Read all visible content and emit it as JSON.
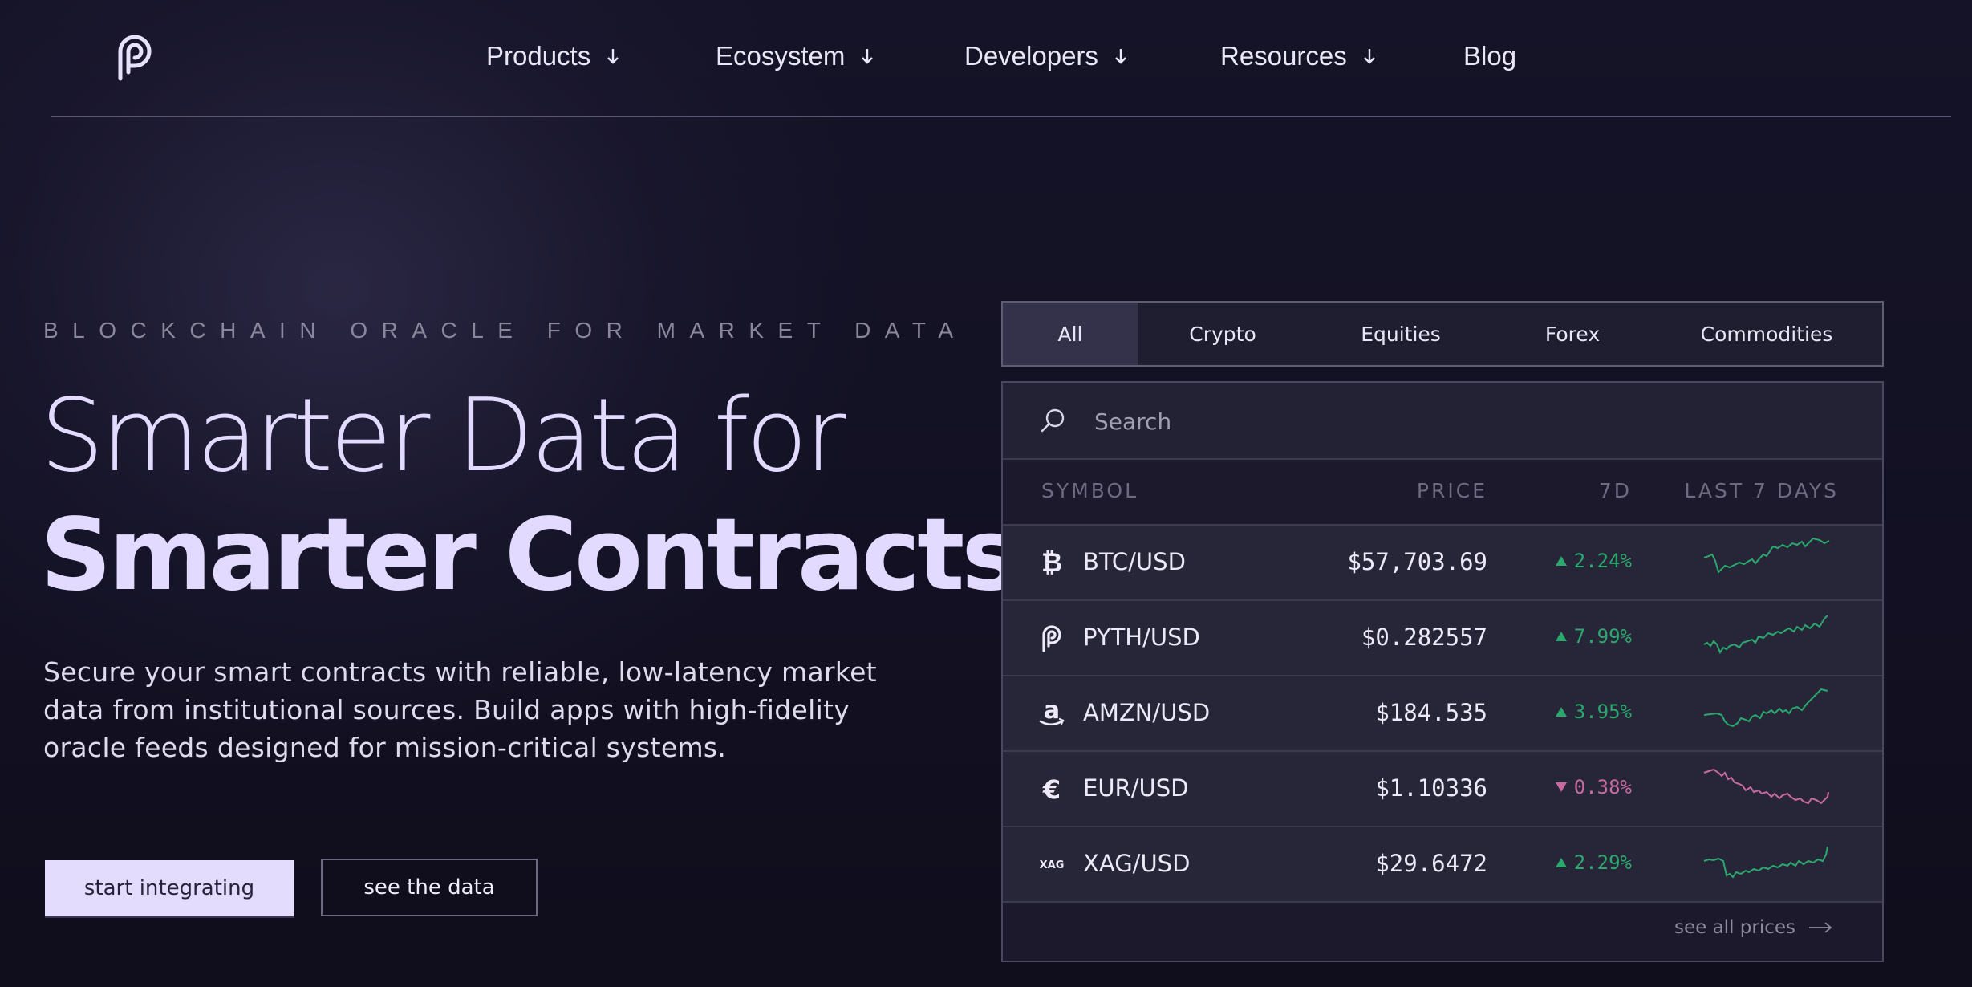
{
  "nav": {
    "items": [
      {
        "label": "Products",
        "has_dropdown": true
      },
      {
        "label": "Ecosystem",
        "has_dropdown": true
      },
      {
        "label": "Developers",
        "has_dropdown": true
      },
      {
        "label": "Resources",
        "has_dropdown": true
      },
      {
        "label": "Blog",
        "has_dropdown": false
      }
    ]
  },
  "hero": {
    "eyebrow": "BLOCKCHAIN ORACLE FOR MARKET DATA",
    "title_line1": "Smarter Data for",
    "title_line2": "Smarter Contracts",
    "description": "Secure your smart contracts with reliable, low-latency market data from institutional sources. Build apps with high-fidelity oracle feeds designed for mission-critical systems.",
    "primary_button": "start integrating",
    "secondary_button": "see the data"
  },
  "prices": {
    "tabs": [
      {
        "label": "All",
        "active": true
      },
      {
        "label": "Crypto",
        "active": false
      },
      {
        "label": "Equities",
        "active": false
      },
      {
        "label": "Forex",
        "active": false
      },
      {
        "label": "Commodities",
        "active": false
      }
    ],
    "search_placeholder": "Search",
    "columns": {
      "symbol": "SYMBOL",
      "price": "PRICE",
      "change": "7D",
      "trend": "LAST 7 DAYS"
    },
    "rows": [
      {
        "icon": "bitcoin-icon",
        "symbol": "BTC/USD",
        "price": "$57,703.69",
        "change": "2.24%",
        "direction": "up",
        "color": "#2aa86d"
      },
      {
        "icon": "pyth-icon",
        "symbol": "PYTH/USD",
        "price": "$0.282557",
        "change": "7.99%",
        "direction": "up",
        "color": "#2aa86d"
      },
      {
        "icon": "amazon-icon",
        "symbol": "AMZN/USD",
        "price": "$184.535",
        "change": "3.95%",
        "direction": "up",
        "color": "#2aa86d"
      },
      {
        "icon": "euro-icon",
        "symbol": "EUR/USD",
        "price": "$1.10336",
        "change": "0.38%",
        "direction": "down",
        "color": "#c76aa0"
      },
      {
        "icon": "xag-icon",
        "icon_text": "XAG",
        "symbol": "XAG/USD",
        "price": "$29.6472",
        "change": "2.29%",
        "direction": "up",
        "color": "#2aa86d"
      }
    ],
    "footer_link": "see all prices"
  },
  "colors": {
    "background": "#12101f",
    "accent": "#e4dcfc",
    "positive": "#2aa86d",
    "negative": "#c76aa0"
  }
}
